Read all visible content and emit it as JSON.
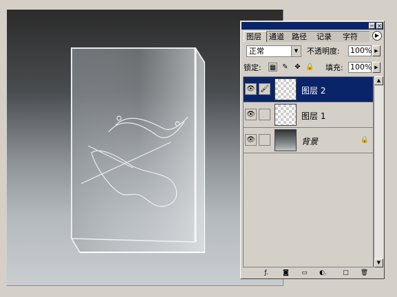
{
  "layers_panel": {
    "title_buttons": [
      "−",
      "×"
    ],
    "tabs": [
      {
        "label": "图层",
        "active": true
      },
      {
        "label": "通道",
        "active": false
      },
      {
        "label": "路径",
        "active": false
      },
      {
        "label": "记录",
        "active": false
      },
      {
        "label": "字符",
        "active": false
      }
    ],
    "menu_arrow": "▶",
    "blend_mode": "正常",
    "opacity_label": "不透明度:",
    "opacity_value": "100%",
    "lock_label": "锁定:",
    "fill_label": "填充:",
    "fill_value": "100%",
    "layers": [
      {
        "name": "图层 2",
        "selected": true,
        "visible": true,
        "linked_brush": true,
        "locked": false
      },
      {
        "name": "图层 1",
        "selected": false,
        "visible": true,
        "linked_brush": false,
        "locked": false
      },
      {
        "name": "背景",
        "selected": false,
        "visible": true,
        "linked_brush": false,
        "locked": true
      }
    ],
    "icons": {
      "eye": "👁",
      "brush": "🖌",
      "lock": "🔒",
      "down_arrow": "▼",
      "up_arrow": "▲",
      "right_arrow": "▶"
    },
    "bottom_icons": [
      "ƒ.",
      "◙",
      "▭",
      "◐.",
      "□",
      "🗑"
    ]
  },
  "colors": {
    "selection": "#0a246a",
    "panel": "#d4d0c8"
  }
}
